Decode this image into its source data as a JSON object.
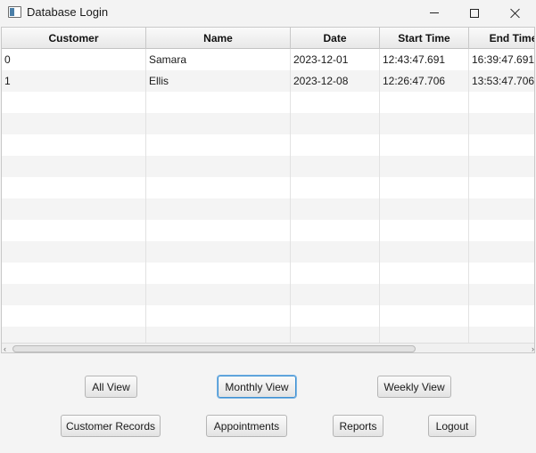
{
  "window": {
    "title": "Database Login",
    "icon": "app-window-icon"
  },
  "table": {
    "columns": [
      "Customer",
      "Name",
      "Date",
      "Start Time",
      "End Time"
    ],
    "rows": [
      [
        "0",
        "Samara",
        "2023-12-01",
        "12:43:47.691",
        "16:39:47.691"
      ],
      [
        "1",
        "Ellis",
        "2023-12-08",
        "12:26:47.706",
        "13:53:47.706"
      ]
    ]
  },
  "buttons": {
    "all_view": "All View",
    "monthly_view": "Monthly View",
    "weekly_view": "Weekly View",
    "customer_records": "Customer Records",
    "appointments": "Appointments",
    "reports": "Reports",
    "logout": "Logout"
  },
  "colors": {
    "focus_border": "#3d8fd1"
  }
}
